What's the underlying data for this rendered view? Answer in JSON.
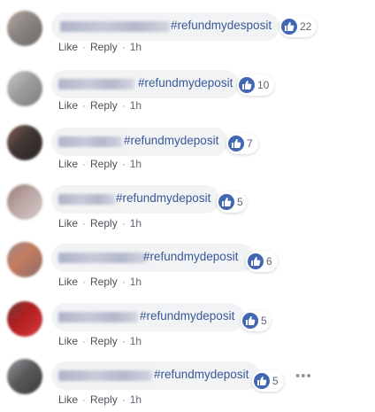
{
  "comments": [
    {
      "hashtag": "#refundmydesposit",
      "likes": "22",
      "like_label": "Like",
      "reply_label": "Reply",
      "sep": "·",
      "time": "1h",
      "avatar_colors": [
        "#8a8583",
        "#b9a79f",
        "#6f6a67"
      ]
    },
    {
      "hashtag": "#refundmydeposit",
      "likes": "10",
      "like_label": "Like",
      "reply_label": "Reply",
      "sep": "·",
      "time": "1h",
      "avatar_colors": [
        "#9e9e9e",
        "#c9c9c9",
        "#7b7b7b"
      ]
    },
    {
      "hashtag": "#refundmydeposit",
      "likes": "7",
      "like_label": "Like",
      "reply_label": "Reply",
      "sep": "·",
      "time": "1h",
      "avatar_colors": [
        "#3f3634",
        "#8a5e54",
        "#2b2524"
      ]
    },
    {
      "hashtag": "#refundmydeposit",
      "likes": "5",
      "like_label": "Like",
      "reply_label": "Reply",
      "sep": "·",
      "time": "1h",
      "avatar_colors": [
        "#b9a6a4",
        "#9c7c7a",
        "#d8cbc9"
      ]
    },
    {
      "hashtag": "#refundmydeposit",
      "likes": "6",
      "like_label": "Like",
      "reply_label": "Reply",
      "sep": "·",
      "time": "1h",
      "avatar_colors": [
        "#c47a5d",
        "#a0898a",
        "#8c6e6d"
      ]
    },
    {
      "hashtag": "#refundmydeposit",
      "likes": "5",
      "like_label": "Like",
      "reply_label": "Reply",
      "sep": "·",
      "time": "1h",
      "avatar_colors": [
        "#b41f21",
        "#6a3a39",
        "#d43a3a"
      ]
    },
    {
      "hashtag": "#refundmydeposit",
      "likes": "5",
      "like_label": "Like",
      "reply_label": "Reply",
      "sep": "·",
      "time": "1h",
      "avatar_colors": [
        "#5b5a5d",
        "#9a9a9e",
        "#3a3a3d"
      ],
      "more": "•••"
    }
  ],
  "colors": {
    "like_blue": "#4267b2",
    "hashtag": "#385898",
    "bubble": "#f2f3f5"
  },
  "icons": {
    "reaction": "thumbs-up-icon",
    "options": "more-options-icon"
  }
}
